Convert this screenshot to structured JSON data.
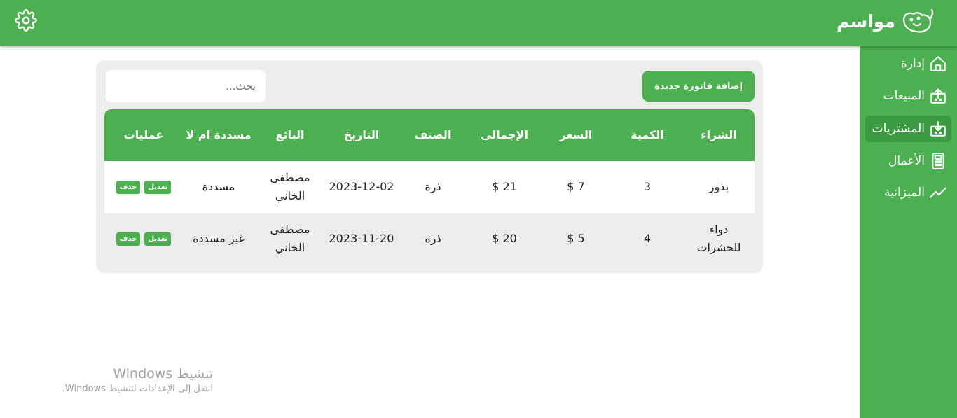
{
  "app": {
    "name": "مواسم"
  },
  "sidebar": {
    "items": [
      {
        "label": "إدارة",
        "icon": "home-icon"
      },
      {
        "label": "المبيعات",
        "icon": "box-out-icon"
      },
      {
        "label": "المشتريات",
        "icon": "box-in-icon",
        "active": true
      },
      {
        "label": "الأعمال",
        "icon": "calculator-icon"
      },
      {
        "label": "الميزانية",
        "icon": "trend-icon"
      }
    ]
  },
  "toolbar": {
    "add_label": "إضافة فاتورة جديدة",
    "search_placeholder": "بحث..."
  },
  "table": {
    "headers": [
      "الشراء",
      "الكمية",
      "السعر",
      "الإجمالي",
      "الصنف",
      "التاريخ",
      "البائع",
      "مسددة ام لا",
      "عمليات"
    ],
    "rows": [
      {
        "item": "بذور",
        "qty": "3",
        "price": "7 $",
        "total": "21 $",
        "category": "ذرة",
        "date": "2023-12-02",
        "seller": "مصطفى الخاني",
        "paid": "مسددة",
        "edit": "تعديل",
        "delete": "حذف"
      },
      {
        "item": "دواء للحشرات",
        "qty": "4",
        "price": "5 $",
        "total": "20 $",
        "category": "ذرة",
        "date": "2023-11-20",
        "seller": "مصطفى الخاني",
        "paid": "غير مسددة",
        "edit": "تعديل",
        "delete": "حذف"
      }
    ]
  },
  "watermark": {
    "title": "تنشيط Windows",
    "subtitle": "انتقل إلى الإعدادات لتنشيط Windows."
  },
  "colors": {
    "primary": "#4caf50",
    "active": "#3e9a42",
    "panel": "#ededed"
  }
}
